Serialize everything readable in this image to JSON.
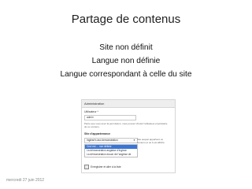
{
  "slide": {
    "title": "Partage de contenus",
    "bullets": [
      "Site non définit",
      "Langue non définie",
      "Langue correspondant à celle du site"
    ],
    "footer_date": "mercredi 27 juin 2012"
  },
  "screenshot": {
    "header": "Administration",
    "field_label": "Utilisateur *",
    "field_value": "admin",
    "field_help": "Parce que vous avez la permission, vous pouvez choisir l'utilisateur propriétaire de ce contenu.",
    "section_label": "Site d'appartenance",
    "select_value": "Inglese's aso demonstration",
    "options": [
      "Ceci est ... non définie",
      "La démonstration anglaise d'Inglese",
      "La démonstration douce de l'anglese de"
    ],
    "side_hint": "Site auquel appartient ce contenu et où il est affiché",
    "checkbox_label": "Enregistrer et aller à la liste"
  }
}
